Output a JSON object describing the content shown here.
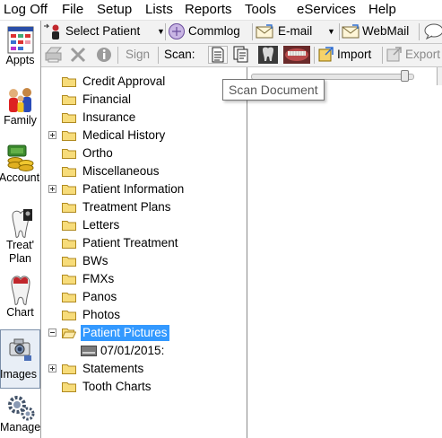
{
  "menu": {
    "items": [
      "Log Off",
      "File",
      "Setup",
      "Lists",
      "Reports",
      "Tools",
      "eServices",
      "Help"
    ]
  },
  "modules": [
    {
      "label": "Appts",
      "icon": "calendar-icon"
    },
    {
      "label": "Family",
      "icon": "family-icon"
    },
    {
      "label": "Account",
      "icon": "coins-icon"
    },
    {
      "label": "Treat' Plan",
      "label_line1": "Treat'",
      "label_line2": "Plan",
      "icon": "tooth-plan-icon"
    },
    {
      "label": "Chart",
      "icon": "tooth-chart-icon"
    },
    {
      "label": "Images",
      "icon": "camera-icon",
      "selected": true
    },
    {
      "label": "Manage",
      "icon": "gears-icon"
    }
  ],
  "toolbar1": {
    "select_patient": "Select Patient",
    "commlog": "Commlog",
    "email": "E-mail",
    "webmail": "WebMail"
  },
  "toolbar2": {
    "sign": "Sign",
    "scan_label": "Scan:",
    "import": "Import",
    "export": "Export"
  },
  "tooltip": "Scan Document",
  "tree": {
    "items": [
      {
        "label": "Credit Approval",
        "expander": "none"
      },
      {
        "label": "Financial",
        "expander": "none"
      },
      {
        "label": "Insurance",
        "expander": "none"
      },
      {
        "label": "Medical History",
        "expander": "plus"
      },
      {
        "label": "Ortho",
        "expander": "none"
      },
      {
        "label": "Miscellaneous",
        "expander": "none"
      },
      {
        "label": "Patient Information",
        "expander": "plus"
      },
      {
        "label": "Treatment Plans",
        "expander": "none"
      },
      {
        "label": "Letters",
        "expander": "none"
      },
      {
        "label": "Patient Treatment",
        "expander": "none"
      },
      {
        "label": "BWs",
        "expander": "none"
      },
      {
        "label": "FMXs",
        "expander": "none"
      },
      {
        "label": "Panos",
        "expander": "none"
      },
      {
        "label": "Photos",
        "expander": "none"
      },
      {
        "label": "Patient Pictures",
        "expander": "minus",
        "selected": true
      },
      {
        "label": "07/01/2015:",
        "child": true
      },
      {
        "label": "Statements",
        "expander": "plus"
      },
      {
        "label": "Tooth Charts",
        "expander": "none"
      }
    ]
  },
  "colors": {
    "selection": "#3399ff",
    "folder": "#f2c94c",
    "toolbar_bg": "#f2f2f2"
  }
}
